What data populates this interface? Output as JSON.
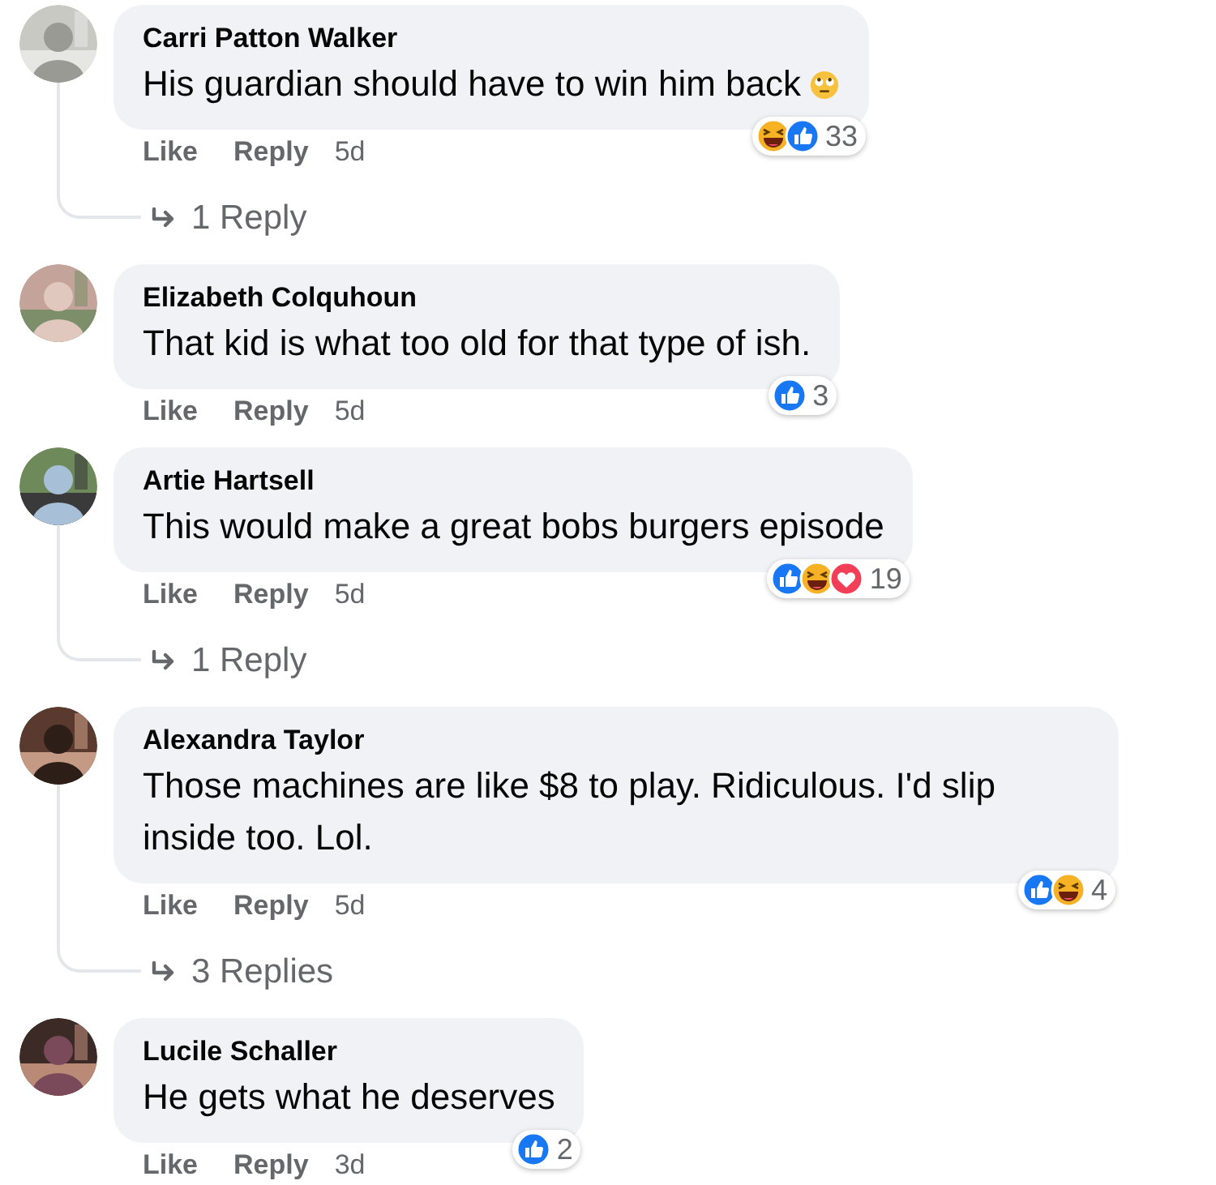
{
  "comments": [
    {
      "author": "Carri Patton Walker",
      "text": "His guardian should have to win him back",
      "trailing_emoji": true,
      "reactions": [
        {
          "kind": "haha"
        },
        {
          "kind": "like"
        }
      ],
      "reaction_count": "33",
      "actions": [
        "Like",
        "Reply"
      ],
      "time": "5d",
      "replies": "1 Reply"
    },
    {
      "author": "Elizabeth Colquhoun",
      "text": "That kid is what too old for that type of ish.",
      "trailing_emoji": false,
      "reactions": [
        {
          "kind": "like"
        }
      ],
      "reaction_count": "3",
      "actions": [
        "Like",
        "Reply"
      ],
      "time": "5d"
    },
    {
      "author": "Artie Hartsell",
      "text": "This would make a great bobs burgers episode",
      "trailing_emoji": false,
      "reactions": [
        {
          "kind": "like"
        },
        {
          "kind": "haha"
        },
        {
          "kind": "love"
        }
      ],
      "reaction_count": "19",
      "actions": [
        "Like",
        "Reply"
      ],
      "time": "5d",
      "replies": "1 Reply"
    },
    {
      "author": "Alexandra Taylor",
      "text": "Those machines are like $8 to play. Ridiculous. I'd slip inside too. Lol.",
      "trailing_emoji": false,
      "reactions": [
        {
          "kind": "like"
        },
        {
          "kind": "haha"
        }
      ],
      "reaction_count": "4",
      "actions": [
        "Like",
        "Reply"
      ],
      "time": "5d",
      "replies": "3 Replies"
    },
    {
      "author": "Lucile Schaller",
      "text": "He gets what he deserves",
      "trailing_emoji": false,
      "reactions": [
        {
          "kind": "like"
        }
      ],
      "reaction_count": "2",
      "actions": [
        "Like",
        "Reply"
      ],
      "time": "3d"
    }
  ]
}
